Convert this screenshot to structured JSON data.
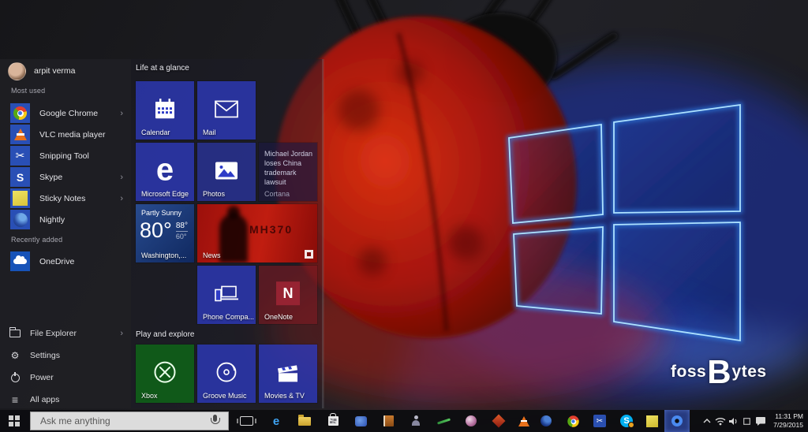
{
  "desktop": {
    "watermark": {
      "pre": "foss",
      "emphasis": "B",
      "post": "ytes"
    }
  },
  "start_menu": {
    "user_name": "arpit verma",
    "most_used_header": "Most used",
    "recently_added_header": "Recently added",
    "chevron": "›",
    "most_used": [
      {
        "label": "Google Chrome",
        "icon": "chrome-icon",
        "has_submenu": true
      },
      {
        "label": "VLC media player",
        "icon": "vlc-icon",
        "has_submenu": false
      },
      {
        "label": "Snipping Tool",
        "icon": "snipping-tool-icon",
        "has_submenu": false
      },
      {
        "label": "Skype",
        "icon": "skype-icon",
        "has_submenu": true
      },
      {
        "label": "Sticky Notes",
        "icon": "sticky-notes-icon",
        "has_submenu": true
      },
      {
        "label": "Nightly",
        "icon": "nightly-icon",
        "has_submenu": false
      }
    ],
    "recently_added": [
      {
        "label": "OneDrive",
        "icon": "onedrive-icon"
      }
    ],
    "system_items": [
      {
        "label": "File Explorer",
        "icon": "file-explorer-icon",
        "has_submenu": true
      },
      {
        "label": "Settings",
        "icon": "settings-icon",
        "has_submenu": false
      },
      {
        "label": "Power",
        "icon": "power-icon",
        "has_submenu": false
      },
      {
        "label": "All apps",
        "icon": "all-apps-icon",
        "has_submenu": false
      }
    ],
    "groups": [
      {
        "title": "Life at a glance"
      },
      {
        "title": "Play and explore"
      }
    ],
    "tiles": {
      "calendar": {
        "label": "Calendar"
      },
      "mail": {
        "label": "Mail"
      },
      "edge": {
        "label": "Microsoft Edge"
      },
      "photos": {
        "label": "Photos"
      },
      "cortana": {
        "headline": "Michael Jordan loses China trademark lawsuit",
        "label": "Cortana"
      },
      "weather": {
        "condition": "Partly Sunny",
        "temperature": "80°",
        "high": "88°",
        "low": "60°",
        "label": "Washington,..."
      },
      "news": {
        "label": "News",
        "image_text": "MH370"
      },
      "phone_companion": {
        "label": "Phone Compa..."
      },
      "onenote": {
        "label": "OneNote"
      },
      "xbox": {
        "label": "Xbox"
      },
      "groove": {
        "label": "Groove Music"
      },
      "movies": {
        "label": "Movies & TV"
      }
    }
  },
  "taskbar": {
    "search_placeholder": "Ask me anything",
    "clock": {
      "time": "11:31 PM",
      "date": "7/29/2015"
    }
  },
  "icons": {
    "edge_glyph": "e",
    "skype_glyph": "S",
    "onenote_glyph": "N",
    "scissors_glyph": "✂",
    "gear_glyph": "⚙",
    "all_apps_glyph": "≡"
  },
  "colors": {
    "tile_accent_blue": "#2e3cc7",
    "xbox_green": "#0f6218",
    "news_red": "#c01d10",
    "weather_blue": "#1c3f88",
    "taskbar_bg": "#0d0d11",
    "start_rail_bg": "#1f1f24",
    "logo_glow_blue": "#4faaff",
    "ladybug_red": "#d81f10"
  }
}
